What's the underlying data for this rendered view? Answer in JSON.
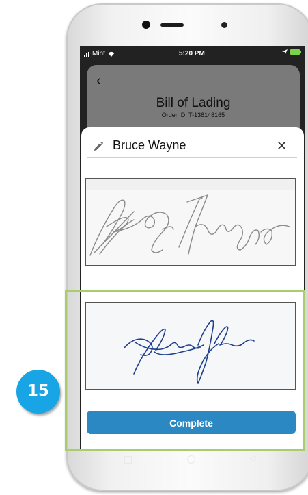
{
  "status_bar": {
    "carrier": "Mint",
    "time": "5:20 PM",
    "icons": [
      "signal-icon",
      "wifi-icon",
      "location-icon",
      "battery-charging-icon"
    ]
  },
  "header": {
    "back_icon": "chevron-left-icon",
    "title": "Bill of Lading",
    "order_id": "Order ID: T-138148165"
  },
  "signature_sheet": {
    "edit_icon": "pencil-icon",
    "signer_name": "Bruce Wayne",
    "close_icon": "close-icon"
  },
  "actions": {
    "complete_label": "Complete"
  },
  "nav_bar": {
    "icons": [
      "recent-apps-icon",
      "home-icon",
      "back-icon"
    ]
  },
  "callout": {
    "step_number": "15"
  },
  "colors": {
    "primary_button": "#2c88c2",
    "highlight_frame": "#a8cd6a",
    "step_badge": "#17a5e6",
    "signature_ink": "#1d3f8e"
  }
}
